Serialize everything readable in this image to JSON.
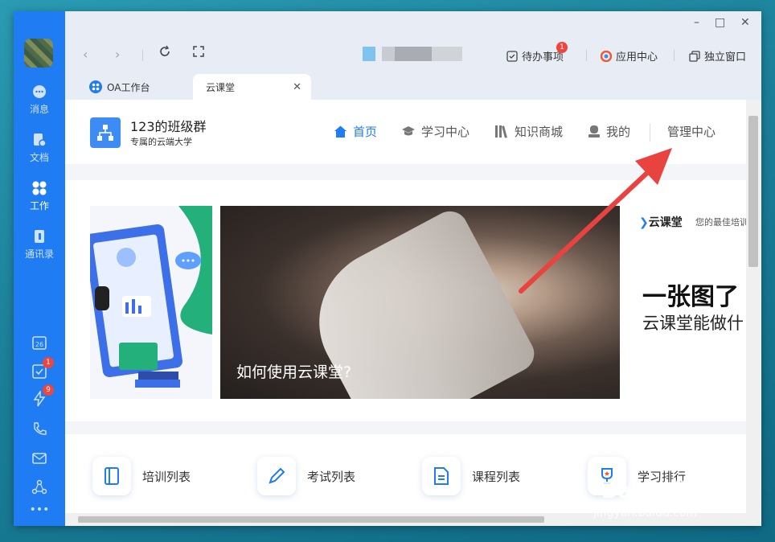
{
  "window": {
    "controls": [
      "–",
      "□",
      "✕"
    ]
  },
  "rail": {
    "items": [
      {
        "label": "消息",
        "icon": "chat-bubble-icon"
      },
      {
        "label": "文档",
        "icon": "document-icon"
      },
      {
        "label": "工作",
        "icon": "apps-grid-icon",
        "active": true
      },
      {
        "label": "通讯录",
        "icon": "contacts-icon"
      }
    ],
    "bottom": [
      {
        "icon": "calendar-icon",
        "text": "26"
      },
      {
        "icon": "todo-check-icon",
        "badge": "1"
      },
      {
        "icon": "lightning-icon",
        "badge": "9"
      },
      {
        "icon": "phone-icon"
      },
      {
        "icon": "mail-icon"
      },
      {
        "icon": "share-nodes-icon"
      },
      {
        "icon": "more-dots-icon"
      }
    ]
  },
  "toolbar": {
    "pending": {
      "label": "待办事项",
      "badge": "1"
    },
    "app_center": "应用中心",
    "standalone": "独立窗口"
  },
  "tabs": [
    {
      "label": "OA工作台",
      "active": false
    },
    {
      "label": "云课堂",
      "active": true
    }
  ],
  "header": {
    "group_title": "123的班级群",
    "group_subtitle": "专属的云端大学",
    "menu": [
      {
        "label": "首页",
        "icon": "home-icon",
        "active": true
      },
      {
        "label": "学习中心",
        "icon": "graduation-cap-icon",
        "active": false
      },
      {
        "label": "知识商城",
        "icon": "books-icon",
        "active": false
      },
      {
        "label": "我的",
        "icon": "user-icon",
        "active": false
      },
      {
        "label": "管理中心",
        "icon": "",
        "active": false
      }
    ]
  },
  "banner": {
    "main_caption": "如何使用云课堂?",
    "right_brand": "云课堂",
    "right_tagline": "您的最佳培训",
    "right_big": "一张图了",
    "right_line": "云课堂能做什"
  },
  "quick_links": [
    {
      "label": "培训列表",
      "icon": "notebook-icon"
    },
    {
      "label": "考试列表",
      "icon": "pencil-icon"
    },
    {
      "label": "课程列表",
      "icon": "file-lines-icon"
    },
    {
      "label": "学习排行",
      "icon": "trophy-icon"
    }
  ],
  "watermark": {
    "brand": "Baidu经验",
    "url": "jingyan.baidu.com"
  },
  "colors": {
    "accent": "#1f7cf2",
    "rail": "#1f7cf2",
    "arrow": "#e8433f"
  }
}
